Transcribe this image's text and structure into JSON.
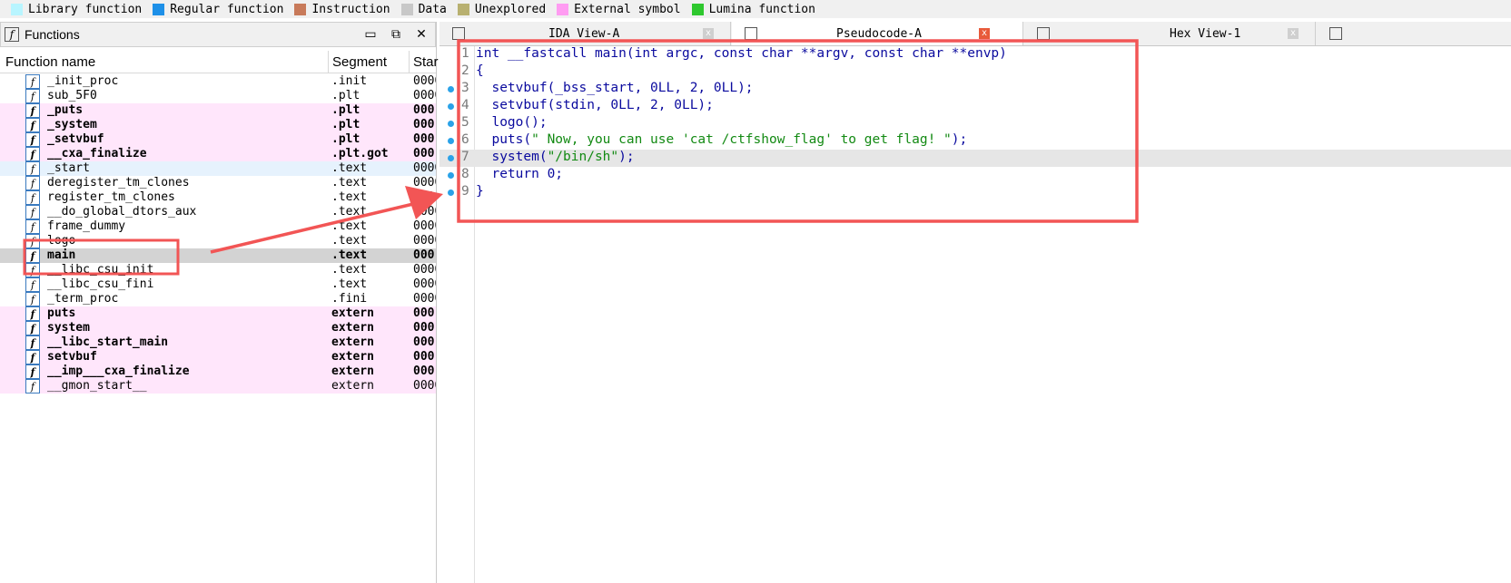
{
  "legend": [
    {
      "label": "Library function",
      "color": "#b8f5ff"
    },
    {
      "label": "Regular function",
      "color": "#1e90e8"
    },
    {
      "label": "Instruction",
      "color": "#c87a5a"
    },
    {
      "label": "Data",
      "color": "#c8c8c8"
    },
    {
      "label": "Unexplored",
      "color": "#b8b070"
    },
    {
      "label": "External symbol",
      "color": "#ff9cf2"
    },
    {
      "label": "Lumina function",
      "color": "#2fc82f"
    }
  ],
  "functions_panel": {
    "title": "Functions",
    "columns": {
      "name": "Function name",
      "segment": "Segment",
      "start": "Star"
    },
    "rows": [
      {
        "name": "_init_proc",
        "segment": ".init",
        "start": "0000",
        "style": "plain"
      },
      {
        "name": "sub_5F0",
        "segment": ".plt",
        "start": "0000",
        "style": "plain"
      },
      {
        "name": "_puts",
        "segment": ".plt",
        "start": "000",
        "style": "pink-bold"
      },
      {
        "name": "_system",
        "segment": ".plt",
        "start": "000",
        "style": "pink-bold"
      },
      {
        "name": "_setvbuf",
        "segment": ".plt",
        "start": "000",
        "style": "pink-bold"
      },
      {
        "name": "__cxa_finalize",
        "segment": ".plt.got",
        "start": "000",
        "style": "pink-bold"
      },
      {
        "name": "_start",
        "segment": ".text",
        "start": "0000",
        "style": "blue"
      },
      {
        "name": "deregister_tm_clones",
        "segment": ".text",
        "start": "0000",
        "style": "plain"
      },
      {
        "name": "register_tm_clones",
        "segment": ".text",
        "start": "0000",
        "style": "plain"
      },
      {
        "name": "__do_global_dtors_aux",
        "segment": ".text",
        "start": "0000",
        "style": "plain"
      },
      {
        "name": "frame_dummy",
        "segment": ".text",
        "start": "0000",
        "style": "plain"
      },
      {
        "name": "logo",
        "segment": ".text",
        "start": "0000",
        "style": "plain"
      },
      {
        "name": "main",
        "segment": ".text",
        "start": "000",
        "style": "selected"
      },
      {
        "name": "__libc_csu_init",
        "segment": ".text",
        "start": "0000",
        "style": "plain"
      },
      {
        "name": "__libc_csu_fini",
        "segment": ".text",
        "start": "0000",
        "style": "plain"
      },
      {
        "name": "_term_proc",
        "segment": ".fini",
        "start": "0000",
        "style": "plain"
      },
      {
        "name": "puts",
        "segment": "extern",
        "start": "000",
        "style": "pink-bold"
      },
      {
        "name": "system",
        "segment": "extern",
        "start": "000",
        "style": "pink-bold"
      },
      {
        "name": "__libc_start_main",
        "segment": "extern",
        "start": "000",
        "style": "pink-bold"
      },
      {
        "name": "setvbuf",
        "segment": "extern",
        "start": "000",
        "style": "pink-bold"
      },
      {
        "name": "__imp___cxa_finalize",
        "segment": "extern",
        "start": "000",
        "style": "pink-bold"
      },
      {
        "name": "__gmon_start__",
        "segment": "extern",
        "start": "0000",
        "style": "pink"
      }
    ]
  },
  "tabs": [
    {
      "label": "IDA View-A",
      "icon": "listing-icon",
      "close": "x",
      "active": false
    },
    {
      "label": "Pseudocode-A",
      "icon": "pseudocode-icon",
      "close": "x",
      "active": true
    },
    {
      "label": "Hex View-1",
      "icon": "hex-icon",
      "close": "x",
      "active": false
    },
    {
      "label": "",
      "icon": "info-icon",
      "close": "",
      "active": false
    }
  ],
  "code_lines": [
    {
      "num": "1",
      "parts": [
        {
          "t": "int __fastcall main(int argc, const char **argv, const char **envp)",
          "s": false
        }
      ],
      "dot": false,
      "hl": false
    },
    {
      "num": "2",
      "parts": [
        {
          "t": "{",
          "s": false
        }
      ],
      "dot": false,
      "hl": false
    },
    {
      "num": "3",
      "parts": [
        {
          "t": "  setvbuf(_bss_start, 0LL, 2, 0LL);",
          "s": false
        }
      ],
      "dot": true,
      "hl": false
    },
    {
      "num": "4",
      "parts": [
        {
          "t": "  setvbuf(stdin, 0LL, 2, 0LL);",
          "s": false
        }
      ],
      "dot": true,
      "hl": false
    },
    {
      "num": "5",
      "parts": [
        {
          "t": "  logo();",
          "s": false
        }
      ],
      "dot": true,
      "hl": false
    },
    {
      "num": "6",
      "parts": [
        {
          "t": "  puts(",
          "s": false
        },
        {
          "t": "\" Now, you can use 'cat /ctfshow_flag' to get flag! \"",
          "s": true
        },
        {
          "t": ");",
          "s": false
        }
      ],
      "dot": true,
      "hl": false
    },
    {
      "num": "7",
      "parts": [
        {
          "t": "  system(",
          "s": false
        },
        {
          "t": "\"/bin/sh\"",
          "s": true
        },
        {
          "t": ");",
          "s": false
        }
      ],
      "dot": true,
      "hl": true
    },
    {
      "num": "8",
      "parts": [
        {
          "t": "  return 0;",
          "s": false
        }
      ],
      "dot": true,
      "hl": false
    },
    {
      "num": "9",
      "parts": [
        {
          "t": "}",
          "s": false
        }
      ],
      "dot": true,
      "hl": false
    }
  ]
}
